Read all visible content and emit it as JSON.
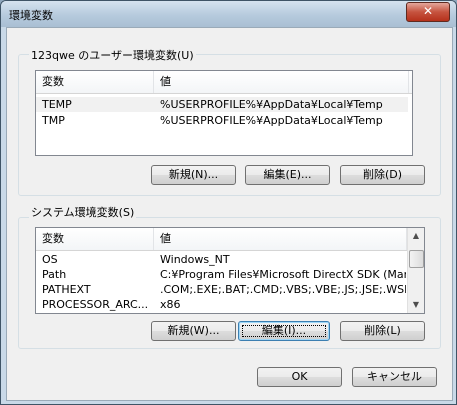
{
  "window": {
    "title": "環境変数",
    "close_label": "✕"
  },
  "user_vars": {
    "group_label": "123qwe のユーザー環境変数(U)",
    "columns": [
      "変数",
      "値"
    ],
    "rows": [
      {
        "name": "TEMP",
        "value": "%USERPROFILE%¥AppData¥Local¥Temp",
        "selected": true
      },
      {
        "name": "TMP",
        "value": "%USERPROFILE%¥AppData¥Local¥Temp",
        "selected": false
      }
    ],
    "buttons": {
      "new": "新規(N)...",
      "edit": "編集(E)...",
      "delete": "削除(D)"
    }
  },
  "system_vars": {
    "group_label": "システム環境変数(S)",
    "columns": [
      "変数",
      "値"
    ],
    "rows": [
      {
        "name": "OS",
        "value": "Windows_NT"
      },
      {
        "name": "Path",
        "value": "C:¥Program Files¥Microsoft DirectX SDK (Mar..."
      },
      {
        "name": "PATHEXT",
        "value": ".COM;.EXE;.BAT;.CMD;.VBS;.VBE;.JS;.JSE;.WSF;..."
      },
      {
        "name": "PROCESSOR_ARC...",
        "value": "x86"
      }
    ],
    "buttons": {
      "new": "新規(W)...",
      "edit": "編集(I)...",
      "delete": "削除(L)"
    }
  },
  "dialog_buttons": {
    "ok": "OK",
    "cancel": "キャンセル"
  }
}
